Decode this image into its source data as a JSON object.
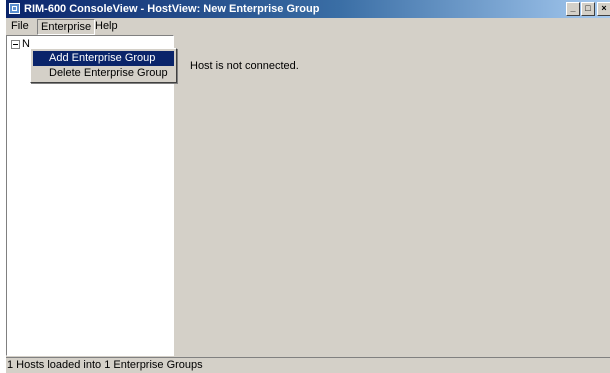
{
  "window": {
    "title": "RIM-600 ConsoleView - HostView: New Enterprise Group",
    "buttons": {
      "minimize": "_",
      "maximize": "□",
      "close": "×"
    }
  },
  "menubar": {
    "items": [
      {
        "label": "File"
      },
      {
        "label": "Enterprise",
        "active": true
      },
      {
        "label": "Help"
      }
    ]
  },
  "enterprise_menu": {
    "items": [
      {
        "label": "Add Enterprise Group",
        "highlighted": true
      },
      {
        "label": "Delete Enterprise Group"
      }
    ]
  },
  "tree": {
    "root": {
      "label": "N",
      "expander": "minus"
    }
  },
  "content": {
    "message": "Host is not connected."
  },
  "statusbar": {
    "text": "1 Hosts loaded into 1 Enterprise Groups"
  },
  "colors": {
    "titlebar_start": "#0a246a",
    "titlebar_end": "#a6caf0",
    "face": "#d4d0c8",
    "menu_highlight": "#0a246a",
    "tree_background": "#ffffff"
  },
  "icons": {
    "app": "app-window-icon",
    "tree_collapse": "minus-box-icon"
  }
}
